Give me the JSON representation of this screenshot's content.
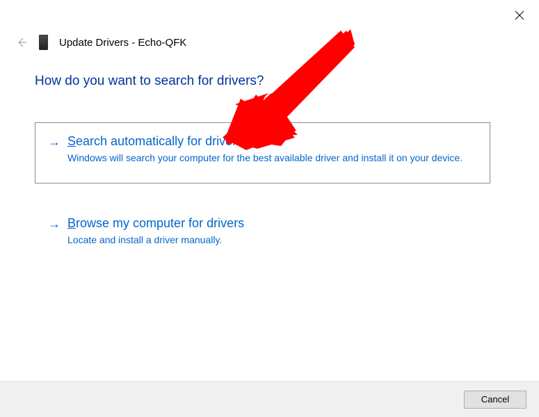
{
  "window": {
    "title": "Update Drivers - Echo-QFK"
  },
  "heading": "How do you want to search for drivers?",
  "options": {
    "auto": {
      "title_prefix": "S",
      "title_rest": "earch automatically for drivers",
      "desc": "Windows will search your computer for the best available driver and install it on your device."
    },
    "browse": {
      "title_prefix": "B",
      "title_rest": "rowse my computer for drivers",
      "desc": "Locate and install a driver manually."
    }
  },
  "buttons": {
    "cancel": "Cancel"
  }
}
